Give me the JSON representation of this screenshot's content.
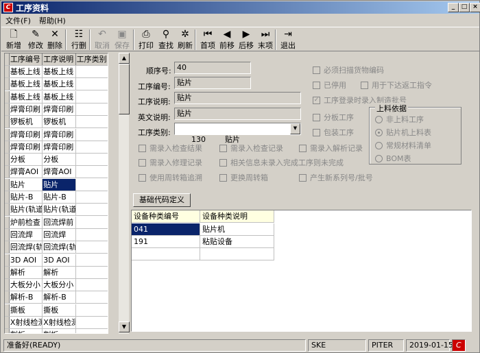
{
  "window": {
    "title": "工序资料",
    "btn_min": "_",
    "btn_max": "□",
    "btn_close": "×",
    "app_icon": "C"
  },
  "menu": [
    "文件(F)",
    "帮助(H)"
  ],
  "toolbar": [
    {
      "label": "新增",
      "icon": "new-icon",
      "glyph": "🗋",
      "enabled": true
    },
    {
      "label": "修改",
      "icon": "edit-icon",
      "glyph": "✎",
      "enabled": true
    },
    {
      "label": "删除",
      "icon": "delete-icon",
      "glyph": "✕",
      "enabled": true
    },
    {
      "label": "行删",
      "icon": "row-delete-icon",
      "glyph": "☷",
      "enabled": true
    },
    {
      "label": "取消",
      "icon": "undo-icon",
      "glyph": "↶",
      "enabled": false
    },
    {
      "label": "保存",
      "icon": "save-icon",
      "glyph": "▣",
      "enabled": false
    },
    {
      "label": "打印",
      "icon": "print-icon",
      "glyph": "⎙",
      "enabled": true
    },
    {
      "label": "查找",
      "icon": "binoculars-icon",
      "glyph": "⚲",
      "enabled": true
    },
    {
      "label": "刷新",
      "icon": "refresh-icon",
      "glyph": "✲",
      "enabled": true
    },
    {
      "label": "首项",
      "icon": "first-icon",
      "glyph": "⏮",
      "enabled": true
    },
    {
      "label": "前移",
      "icon": "prev-icon",
      "glyph": "◀",
      "enabled": true
    },
    {
      "label": "后移",
      "icon": "next-icon",
      "glyph": "▶",
      "enabled": true
    },
    {
      "label": "末项",
      "icon": "last-icon",
      "glyph": "⏭",
      "enabled": true
    },
    {
      "label": "退出",
      "icon": "exit-icon",
      "glyph": "⇥",
      "enabled": true
    }
  ],
  "left_grid": {
    "headers": [
      "工序编号",
      "工序说明",
      "工序类别"
    ],
    "rows": [
      [
        "基板上线",
        "基板上线",
        ""
      ],
      [
        "基板上线",
        "基板上线",
        ""
      ],
      [
        "基板上线",
        "基板上线",
        ""
      ],
      [
        "焊膏印刷",
        "焊膏印刷",
        ""
      ],
      [
        "锣板机",
        "锣板机",
        ""
      ],
      [
        "焊膏印刷",
        "焊膏印刷",
        ""
      ],
      [
        "焊膏印刷",
        "焊膏印刷",
        ""
      ],
      [
        "分板",
        "分板",
        ""
      ],
      [
        "焊膏AOI",
        "焊膏AOI",
        ""
      ],
      [
        "贴片",
        "贴片",
        ""
      ],
      [
        "贴片-B",
        "贴片-B",
        ""
      ],
      [
        "贴片(轨道",
        "贴片(轨道",
        ""
      ],
      [
        "炉前检查",
        "回流焊前",
        ""
      ],
      [
        "回流焊",
        "回流焊",
        ""
      ],
      [
        "回流焊(轨",
        "回流焊(轨",
        ""
      ],
      [
        "3D AOI",
        "3D AOI",
        ""
      ],
      [
        "解析",
        "解析",
        ""
      ],
      [
        "大板分小",
        "大板分小",
        ""
      ],
      [
        "解析-B",
        "解析-B",
        ""
      ],
      [
        "撕板",
        "撕板",
        ""
      ],
      [
        "X射线检测",
        "X射线检测",
        ""
      ],
      [
        "割板",
        "割板",
        ""
      ]
    ],
    "selected_row": 9
  },
  "form": {
    "seq_label": "顺序号:",
    "seq_value": "40",
    "code_label": "工序编号:",
    "code_value": "贴片",
    "desc_label": "工序说明:",
    "desc_value": "贴片",
    "en_label": "英文说明:",
    "en_value": "贴片",
    "cat_label": "工序类别:",
    "cat_value": "130        贴片",
    "checkboxes_right": [
      {
        "label": "必须扫描货物编码",
        "checked": false
      },
      {
        "label": "已停用",
        "checked": false
      },
      {
        "label": "用于下达返工指令",
        "checked": false
      },
      {
        "label": "工序登录时录入制造批号",
        "checked": true
      },
      {
        "label": "分板工序",
        "checked": false
      },
      {
        "label": "包装工序",
        "checked": false
      }
    ],
    "checkboxes_bottom": [
      {
        "label": "需录入检查结果",
        "checked": false
      },
      {
        "label": "需录入检查记录",
        "checked": false
      },
      {
        "label": "需录入解析记录",
        "checked": false
      },
      {
        "label": "需录入修理记录",
        "checked": false
      },
      {
        "label": "相关信息未录入完成工序则未完成",
        "checked": false
      },
      {
        "label": "使用周转箱追溯",
        "checked": false
      },
      {
        "label": "更换周转箱",
        "checked": false
      },
      {
        "label": "产生新系列号/批号",
        "checked": false
      }
    ],
    "group_title": "上料依据",
    "radios": [
      {
        "label": "非上料工序",
        "checked": false
      },
      {
        "label": "贴片机上料表",
        "checked": true
      },
      {
        "label": "常规材料清单",
        "checked": false
      },
      {
        "label": "BOM表",
        "checked": false
      }
    ]
  },
  "base_code_button": "基础代码定义",
  "device_grid": {
    "headers": [
      "设备种类编号",
      "设备种类说明"
    ],
    "rows": [
      [
        "041",
        "贴片机"
      ],
      [
        "191",
        "粘贴设备"
      ],
      [
        "",
        ""
      ]
    ],
    "selected_row": 0
  },
  "status": {
    "ready": "准备好(READY)",
    "user": "SKE",
    "host": "PITER",
    "date": "2019-01-15"
  }
}
